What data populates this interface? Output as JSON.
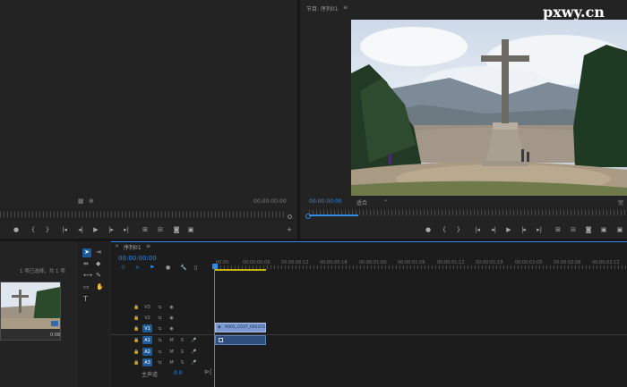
{
  "watermark": "pxwy.cn",
  "source_monitor": {
    "timecode": "00:00:00:00"
  },
  "program_monitor": {
    "title": "节目: 序列01",
    "menu_glyph": "≡",
    "timecode": "00:00:00:00",
    "fit": "适合",
    "fit_arrow": "⌄",
    "quality": "完"
  },
  "project": {
    "status": "1 项已选择，共 1 项",
    "clip_duration": "0:08"
  },
  "timeline": {
    "tab": "序列01",
    "tab_close": "×",
    "tab_menu": "≡",
    "timecode": "00:00:00:00",
    "ruler": [
      "00:00",
      "00:00:00:06",
      "00:00:00:12",
      "00:00:00:18",
      "00:00:01:00",
      "00:00:01:06",
      "00:00:01:12",
      "00:00:01:18",
      "00:00:02:00",
      "00:00:02:06",
      "00:00:02:12"
    ],
    "video_tracks": [
      "V3",
      "V2",
      "V1"
    ],
    "audio_tracks": [
      "A1",
      "A2",
      "A3"
    ],
    "master_label": "主声道",
    "master_value": "0.0",
    "clip_label": "A001_C037_0921FG"
  },
  "colors": {
    "accent": "#2d8ceb",
    "clip_video": "#7a9ad0",
    "clip_audio": "#2e4f7e",
    "work_area": "#c8b400"
  }
}
